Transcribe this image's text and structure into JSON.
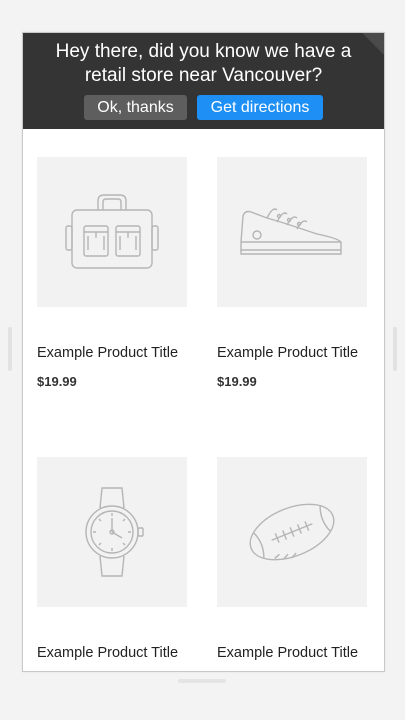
{
  "banner": {
    "message": "Hey there, did you know we have a retail store near Vancouver?",
    "dismiss_label": "Ok, thanks",
    "directions_label": "Get directions",
    "colors": {
      "background": "#343434",
      "dismiss": "#5e5e5e",
      "directions": "#1e90f5"
    }
  },
  "products": [
    {
      "title": "Example Product Title",
      "price": "$19.99",
      "icon": "bag-icon"
    },
    {
      "title": "Example Product Title",
      "price": "$19.99",
      "icon": "sneaker-icon"
    },
    {
      "title": "Example Product Title",
      "price": "",
      "icon": "watch-icon"
    },
    {
      "title": "Example Product Title",
      "price": "",
      "icon": "football-icon"
    }
  ]
}
